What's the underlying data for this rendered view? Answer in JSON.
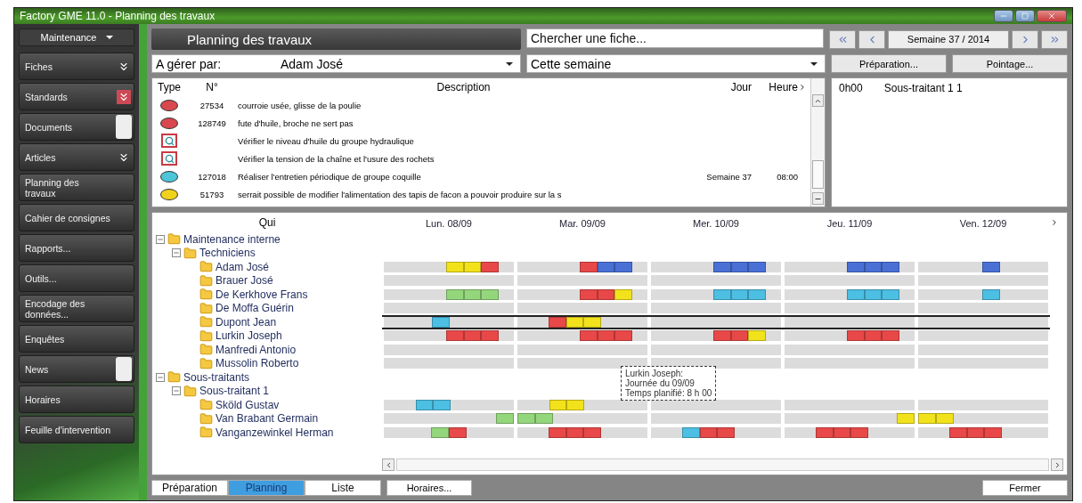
{
  "window": {
    "title": "Factory GME 11.0 - Planning des travaux"
  },
  "sidebar": {
    "module": "Maintenance",
    "items": [
      {
        "label": "Fiches",
        "kind": "section",
        "highlight": false
      },
      {
        "label": "Standards",
        "kind": "section",
        "highlight": true
      },
      {
        "label": "Documents",
        "kind": "tagged"
      },
      {
        "label": "Articles",
        "kind": "section",
        "highlight": false
      },
      {
        "label": "Planning des travaux",
        "kind": "link"
      },
      {
        "label": "Cahier de consignes",
        "kind": "link"
      },
      {
        "label": "Rapports...",
        "kind": "link"
      },
      {
        "label": "Outils...",
        "kind": "link"
      },
      {
        "label": "Encodage des données...",
        "kind": "link"
      },
      {
        "label": "Enquêtes",
        "kind": "link"
      },
      {
        "label": "News",
        "kind": "tagged"
      },
      {
        "label": "Horaires",
        "kind": "link"
      },
      {
        "label": "Feuille d'intervention",
        "kind": "link"
      }
    ]
  },
  "header": {
    "title": "Planning des travaux",
    "search": {
      "placeholder": "Chercher une fiche..."
    },
    "week": "Semaine 37 / 2014"
  },
  "filters": {
    "manager_label": "A gérer par:",
    "manager": "Adam José",
    "period": "Cette semaine",
    "buttons": [
      "Préparation...",
      "Pointage..."
    ]
  },
  "tasks": {
    "columns": [
      "Type",
      "N°",
      "Description",
      "Jour",
      "Heure"
    ],
    "rows": [
      {
        "kind": "dot",
        "color": "#d9484f",
        "number": "27534",
        "description": "courroie usée, glisse de la poulie"
      },
      {
        "kind": "dot",
        "color": "#d9484f",
        "number": "128749",
        "description": "fute d'huile, broche ne sert pas"
      },
      {
        "kind": "inspection",
        "description": "Vérifier le niveau d'huile du groupe hydraulique"
      },
      {
        "kind": "inspection",
        "description": "Vérifier la tension de la chaîne et l'usure des rochets"
      },
      {
        "kind": "dot",
        "color": "#4cc6d8",
        "number": "127018",
        "description": "Réaliser l'entretien périodique de groupe coquille",
        "day": "Semaine 37",
        "hour": "08:00"
      },
      {
        "kind": "dot",
        "color": "#f0d21c",
        "number": "51793",
        "description": "serrait possible de modifier l'alimentation des tapis de facon a pouvoir produire  sur la s"
      }
    ]
  },
  "assignments": [
    {
      "time": "0h00",
      "name": "Sous-traitant 1 1"
    }
  ],
  "planning": {
    "tree_header": "Qui",
    "days": [
      "Lun. 08/09",
      "Mar. 09/09",
      "Mer. 10/09",
      "Jeu. 11/09",
      "Ven. 12/09"
    ],
    "tree": [
      {
        "label": "Maintenance interne",
        "expanded": true,
        "children": [
          {
            "label": "Techniciens",
            "expanded": true,
            "children": [
              {
                "label": "Adam José",
                "selected": false,
                "days": [
                  [
                    {
                      "busy": false
                    },
                    {
                      "busy": false
                    },
                    {
                      "busy": false
                    },
                    {
                      "busy": false
                    },
                    {
                      "busy": true,
                      "color": "#f2e21b"
                    },
                    {
                      "busy": true,
                      "color": "#f2e21b"
                    },
                    {
                      "busy": true,
                      "color": "#e84848"
                    },
                    {
                      "busy": false
                    }
                  ],
                  [
                    {
                      "busy": false
                    },
                    {
                      "busy": false
                    },
                    {
                      "busy": false
                    },
                    {
                      "busy": false
                    },
                    {
                      "busy": true,
                      "color": "#e84848"
                    },
                    {
                      "busy": true,
                      "color": "#4a70d6"
                    },
                    {
                      "busy": true,
                      "color": "#4a70d6"
                    },
                    {
                      "busy": false
                    }
                  ],
                  [
                    {
                      "busy": false
                    },
                    {
                      "busy": false
                    },
                    {
                      "busy": false
                    },
                    {
                      "busy": false
                    },
                    {
                      "busy": true,
                      "color": "#4a70d6"
                    },
                    {
                      "busy": true,
                      "color": "#4a70d6"
                    },
                    {
                      "busy": true,
                      "color": "#4a70d6"
                    },
                    {
                      "busy": false
                    }
                  ],
                  [
                    {
                      "busy": false
                    },
                    {
                      "busy": false
                    },
                    {
                      "busy": false
                    },
                    {
                      "busy": false
                    },
                    {
                      "busy": true,
                      "color": "#4a70d6"
                    },
                    {
                      "busy": true,
                      "color": "#4a70d6"
                    },
                    {
                      "busy": true,
                      "color": "#4a70d6"
                    },
                    {
                      "busy": false
                    }
                  ],
                  [
                    {
                      "busy": false
                    },
                    {
                      "busy": false
                    },
                    {
                      "busy": false
                    },
                    {
                      "busy": false
                    },
                    {
                      "busy": true,
                      "color": "#4a70d6"
                    },
                    {
                      "busy": false
                    },
                    {
                      "busy": false
                    },
                    {
                      "busy": false
                    }
                  ]
                ]
              },
              {
                "label": "Brauer José",
                "selected": false
              },
              {
                "label": "De Kerkhove Frans",
                "selected": false,
                "days": [
                  [
                    {
                      "busy": false
                    },
                    {
                      "busy": false
                    },
                    {
                      "busy": false
                    },
                    {
                      "busy": false
                    },
                    {
                      "busy": true,
                      "color": "#94d67c"
                    },
                    {
                      "busy": true,
                      "color": "#94d67c"
                    },
                    {
                      "busy": true,
                      "color": "#94d67c"
                    },
                    {
                      "busy": false
                    }
                  ],
                  [
                    {
                      "busy": false
                    },
                    {
                      "busy": false
                    },
                    {
                      "busy": false
                    },
                    {
                      "busy": false
                    },
                    {
                      "busy": true,
                      "color": "#e84848"
                    },
                    {
                      "busy": true,
                      "color": "#e84848"
                    },
                    {
                      "busy": true,
                      "color": "#f2e21b"
                    },
                    {
                      "busy": false
                    }
                  ],
                  [
                    {
                      "busy": false
                    },
                    {
                      "busy": false
                    },
                    {
                      "busy": false
                    },
                    {
                      "busy": false
                    },
                    {
                      "busy": true,
                      "color": "#4cbfe3"
                    },
                    {
                      "busy": true,
                      "color": "#4cbfe3"
                    },
                    {
                      "busy": true,
                      "color": "#4cbfe3"
                    },
                    {
                      "busy": false
                    }
                  ],
                  [
                    {
                      "busy": false
                    },
                    {
                      "busy": false
                    },
                    {
                      "busy": false
                    },
                    {
                      "busy": false
                    },
                    {
                      "busy": true,
                      "color": "#4cbfe3"
                    },
                    {
                      "busy": true,
                      "color": "#4cbfe3"
                    },
                    {
                      "busy": true,
                      "color": "#4cbfe3"
                    },
                    {
                      "busy": false
                    }
                  ],
                  [
                    {
                      "busy": false
                    },
                    {
                      "busy": false
                    },
                    {
                      "busy": false
                    },
                    {
                      "busy": false
                    },
                    {
                      "busy": true,
                      "color": "#4cbfe3"
                    },
                    {
                      "busy": false
                    },
                    {
                      "busy": false
                    },
                    {
                      "busy": false
                    }
                  ]
                ]
              },
              {
                "label": "De Moffa Guérin",
                "selected": false
              },
              {
                "label": "Dupont Jean",
                "selected": true,
                "days": [
                  [
                    {
                      "busy": false
                    },
                    {
                      "busy": false
                    },
                    {
                      "busy": false
                    },
                    {
                      "busy": true,
                      "color": "#4cbfe3"
                    },
                    {
                      "busy": false
                    },
                    {
                      "busy": false
                    },
                    {
                      "busy": false
                    },
                    {
                      "busy": false
                    }
                  ],
                  [
                    {
                      "busy": false
                    },
                    {
                      "busy": false
                    },
                    {
                      "busy": true,
                      "color": "#e84848"
                    },
                    {
                      "busy": true,
                      "color": "#f2e21b"
                    },
                    {
                      "busy": true,
                      "color": "#f2e21b"
                    },
                    {
                      "busy": false
                    },
                    {
                      "busy": false
                    },
                    {
                      "busy": false
                    }
                  ]
                ]
              },
              {
                "label": "Lurkin Joseph",
                "selected": false,
                "days": [
                  [
                    {
                      "busy": false
                    },
                    {
                      "busy": false
                    },
                    {
                      "busy": false
                    },
                    {
                      "busy": false
                    },
                    {
                      "busy": true,
                      "color": "#e84848"
                    },
                    {
                      "busy": true,
                      "color": "#e84848"
                    },
                    {
                      "busy": true,
                      "color": "#e84848"
                    },
                    {
                      "busy": false
                    }
                  ],
                  [
                    {
                      "busy": false
                    },
                    {
                      "busy": false
                    },
                    {
                      "busy": false
                    },
                    {
                      "busy": false
                    },
                    {
                      "busy": true,
                      "color": "#e84848"
                    },
                    {
                      "busy": true,
                      "color": "#e84848"
                    },
                    {
                      "busy": true,
                      "color": "#e84848"
                    },
                    {
                      "busy": false
                    }
                  ],
                  [
                    {
                      "busy": false
                    },
                    {
                      "busy": false
                    },
                    {
                      "busy": false
                    },
                    {
                      "busy": false
                    },
                    {
                      "busy": true,
                      "color": "#e84848"
                    },
                    {
                      "busy": true,
                      "color": "#e84848"
                    },
                    {
                      "busy": true,
                      "color": "#f2e21b"
                    },
                    {
                      "busy": false
                    }
                  ],
                  [
                    {
                      "busy": false
                    },
                    {
                      "busy": false
                    },
                    {
                      "busy": false
                    },
                    {
                      "busy": false
                    },
                    {
                      "busy": true,
                      "color": "#e84848"
                    },
                    {
                      "busy": true,
                      "color": "#e84848"
                    },
                    {
                      "busy": true,
                      "color": "#e84848"
                    },
                    {
                      "busy": false
                    }
                  ]
                ]
              },
              {
                "label": "Manfredi Antonio",
                "selected": false
              },
              {
                "label": "Mussolin Roberto",
                "selected": false
              }
            ]
          }
        ]
      },
      {
        "label": "Sous-traitants",
        "expanded": true,
        "children": [
          {
            "label": "Sous-traitant 1",
            "expanded": true,
            "children": [
              {
                "label": "Sköld Gustav",
                "selected": false,
                "days": [
                  [
                    {
                      "busy": false
                    },
                    {
                      "busy": false
                    },
                    {
                      "busy": true,
                      "color": "#4cbfe3"
                    },
                    {
                      "busy": true,
                      "color": "#4cbfe3"
                    },
                    {
                      "busy": false
                    },
                    {
                      "busy": false
                    },
                    {
                      "busy": false
                    },
                    {
                      "busy": false
                    }
                  ],
                  [
                    {
                      "busy": false
                    },
                    {
                      "busy": false
                    },
                    {
                      "busy": true,
                      "color": "#f2e21b"
                    },
                    {
                      "busy": true,
                      "color": "#f2e21b"
                    },
                    {
                      "busy": false
                    },
                    {
                      "busy": false
                    },
                    {
                      "busy": false
                    },
                    {
                      "busy": false
                    }
                  ]
                ]
              },
              {
                "label": "Van Brabant Germain",
                "selected": false,
                "days": [
                  [
                    {
                      "busy": false
                    },
                    {
                      "busy": false
                    },
                    {
                      "busy": false
                    },
                    {
                      "busy": false
                    },
                    {
                      "busy": false
                    },
                    {
                      "busy": false
                    },
                    {
                      "busy": false
                    },
                    {
                      "busy": true,
                      "color": "#94d67c"
                    }
                  ],
                  [
                    {
                      "busy": true,
                      "color": "#94d67c"
                    },
                    {
                      "busy": true,
                      "color": "#94d67c"
                    },
                    {
                      "busy": false
                    },
                    {
                      "busy": false
                    },
                    {
                      "busy": false
                    },
                    {
                      "busy": false
                    },
                    {
                      "busy": false
                    },
                    {
                      "busy": false
                    }
                  ],
                  [
                    {
                      "busy": false
                    },
                    {
                      "busy": false
                    },
                    {
                      "busy": false
                    },
                    {
                      "busy": false
                    },
                    {
                      "busy": false
                    },
                    {
                      "busy": false
                    },
                    {
                      "busy": false
                    },
                    {
                      "busy": false
                    }
                  ],
                  [
                    {
                      "busy": false
                    },
                    {
                      "busy": false
                    },
                    {
                      "busy": false
                    },
                    {
                      "busy": false
                    },
                    {
                      "busy": false
                    },
                    {
                      "busy": false
                    },
                    {
                      "busy": false
                    },
                    {
                      "busy": true,
                      "color": "#f2e21b"
                    }
                  ],
                  [
                    {
                      "busy": true,
                      "color": "#f2e21b"
                    },
                    {
                      "busy": true,
                      "color": "#f2e21b"
                    },
                    {
                      "busy": false
                    },
                    {
                      "busy": false
                    },
                    {
                      "busy": false
                    },
                    {
                      "busy": false
                    },
                    {
                      "busy": false
                    },
                    {
                      "busy": false
                    }
                  ]
                ]
              },
              {
                "label": "Vanganzewinkel Herman",
                "selected": false,
                "days": [
                  [
                    {
                      "busy": false
                    },
                    {
                      "busy": false
                    },
                    {
                      "busy": false
                    },
                    {
                      "busy": true,
                      "color": "#94d67c"
                    },
                    {
                      "busy": true,
                      "color": "#e84848"
                    },
                    {
                      "busy": false
                    },
                    {
                      "busy": false
                    },
                    {
                      "busy": false
                    }
                  ],
                  [
                    {
                      "busy": false
                    },
                    {
                      "busy": false
                    },
                    {
                      "busy": true,
                      "color": "#e84848"
                    },
                    {
                      "busy": true,
                      "color": "#e84848"
                    },
                    {
                      "busy": true,
                      "color": "#e84848"
                    },
                    {
                      "busy": false
                    },
                    {
                      "busy": false
                    },
                    {
                      "busy": false
                    }
                  ],
                  [
                    {
                      "busy": false
                    },
                    {
                      "busy": false
                    },
                    {
                      "busy": true,
                      "color": "#4cbfe3"
                    },
                    {
                      "busy": true,
                      "color": "#e84848"
                    },
                    {
                      "busy": true,
                      "color": "#e84848"
                    },
                    {
                      "busy": false
                    },
                    {
                      "busy": false
                    },
                    {
                      "busy": false
                    }
                  ],
                  [
                    {
                      "busy": false
                    },
                    {
                      "busy": false
                    },
                    {
                      "busy": true,
                      "color": "#e84848"
                    },
                    {
                      "busy": true,
                      "color": "#e84848"
                    },
                    {
                      "busy": true,
                      "color": "#e84848"
                    },
                    {
                      "busy": false
                    },
                    {
                      "busy": false
                    },
                    {
                      "busy": false
                    }
                  ],
                  [
                    {
                      "busy": false
                    },
                    {
                      "busy": false
                    },
                    {
                      "busy": true,
                      "color": "#e84848"
                    },
                    {
                      "busy": true,
                      "color": "#e84848"
                    },
                    {
                      "busy": true,
                      "color": "#e84848"
                    },
                    {
                      "busy": false
                    },
                    {
                      "busy": false
                    },
                    {
                      "busy": false
                    }
                  ]
                ]
              }
            ]
          }
        ]
      }
    ],
    "tooltip": [
      "Lurkin Joseph:",
      "Journée du 09/09",
      "Temps planifié: 8 h 00"
    ]
  },
  "tabs": [
    {
      "label": "Préparation",
      "selected": false
    },
    {
      "label": "Planning",
      "selected": true
    },
    {
      "label": "Liste",
      "selected": false
    }
  ],
  "schedule_button": "Horaires...",
  "close_button": "Fermer"
}
